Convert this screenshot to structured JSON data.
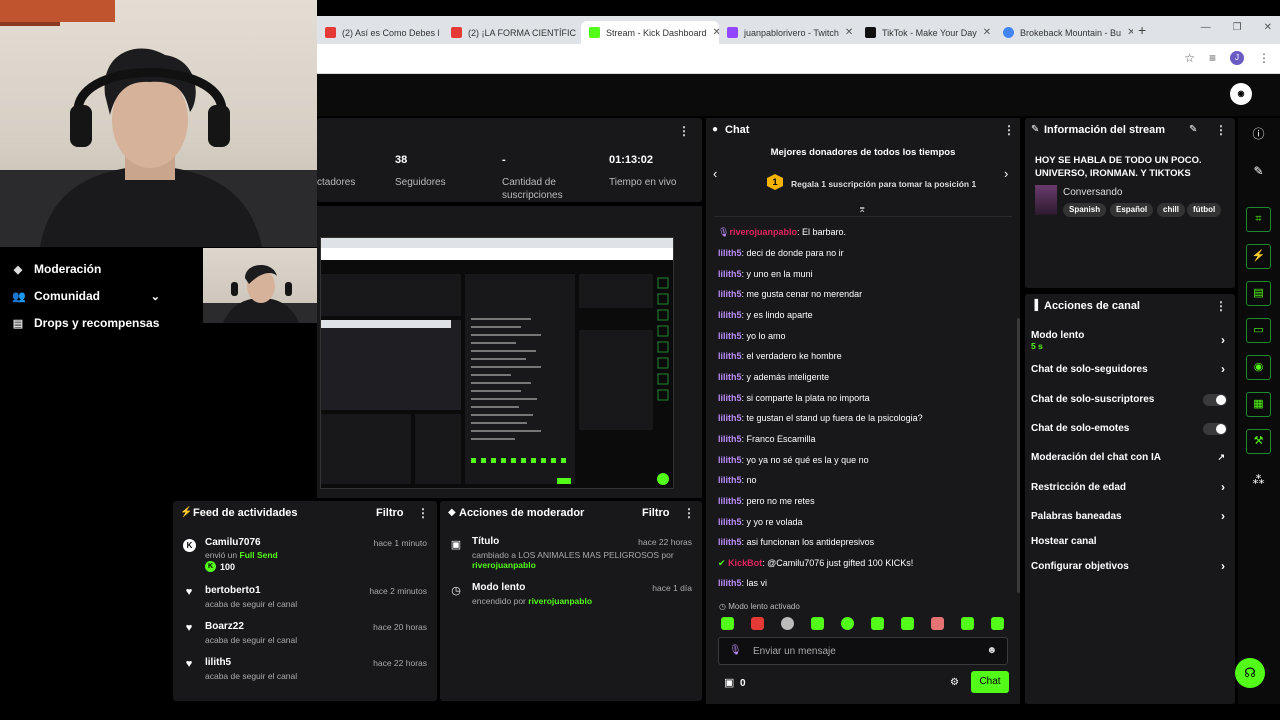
{
  "browser": {
    "tabs": [
      {
        "label": "(2) Así es Como Debes Er",
        "fav": "#e53935"
      },
      {
        "label": "(2) ¡LA FORMA CIENTÍFIC",
        "fav": "#e53935"
      },
      {
        "label": "Stream - Kick Dashboard",
        "fav": "#53fc18",
        "active": true
      },
      {
        "label": "juanpablorivero - Twitch",
        "fav": "#9146ff"
      },
      {
        "label": "TikTok - Make Your Day",
        "fav": "#111111"
      },
      {
        "label": "Brokeback Mountain - Bu",
        "fav": "#4285f4"
      }
    ],
    "profile_letter": "J"
  },
  "nav": {
    "items": [
      {
        "label": "Moderación",
        "icon": "shield-icon"
      },
      {
        "label": "Comunidad",
        "icon": "people-icon"
      },
      {
        "label": "Drops y recompensas",
        "icon": "gift-icon"
      }
    ]
  },
  "stats": {
    "espectadores_label": "ctadores",
    "seguidores_value": "38",
    "seguidores_label": "Seguidores",
    "subs_value": "-",
    "subs_label": "Cantidad de suscripciones",
    "tiempo_value": "01:13:02",
    "tiempo_label": "Tiempo en vivo"
  },
  "feed": {
    "title": "Feed de actividades",
    "filter": "Filtro",
    "items": [
      {
        "name": "Camilu7076",
        "sub_prefix": "envió un ",
        "sub_highlight": "Full Send",
        "extra": "100",
        "time": "hace 1 minuto",
        "icon": "kick-icon"
      },
      {
        "name": "bertoberto1",
        "sub": "acaba de seguir el canal",
        "time": "hace 2 minutos",
        "icon": "heart-icon"
      },
      {
        "name": "Boarz22",
        "sub": "acaba de seguir el canal",
        "time": "hace 20 horas",
        "icon": "heart-icon"
      },
      {
        "name": "lilith5",
        "sub": "acaba de seguir el canal",
        "time": "hace 22 horas",
        "icon": "heart-icon"
      }
    ]
  },
  "modactions": {
    "title": "Acciones de moderador",
    "filter": "Filtro",
    "items": [
      {
        "name": "Título",
        "line1": "cambiado a LOS ANIMALES MAS PELIGROSOS por",
        "user": "riverojuanpablo",
        "time": "hace 22 horas"
      },
      {
        "name": "Modo lento",
        "line1": "encendido por",
        "user": "riverojuanpablo",
        "time": "hace 1 día"
      }
    ]
  },
  "chat": {
    "title": "Chat",
    "donors_title": "Mejores donadores de todos los tiempos",
    "donors_rank": "1",
    "donors_text": "Regala 1 suscripción para tomar la posición 1",
    "messages": [
      {
        "user": "riverojuanpablo",
        "text": "El barbaro.",
        "color": "red"
      },
      {
        "user": "lilith5",
        "text": "deci de donde para no ir"
      },
      {
        "user": "lilith5",
        "text": "y uno en la muni"
      },
      {
        "user": "lilith5",
        "text": "me gusta cenar no merendar"
      },
      {
        "user": "lilith5",
        "text": "y es lindo aparte"
      },
      {
        "user": "lilith5",
        "text": "yo lo amo"
      },
      {
        "user": "lilith5",
        "text": "el verdadero ke hombre"
      },
      {
        "user": "lilith5",
        "text": "y además inteligente"
      },
      {
        "user": "lilith5",
        "text": "si comparte la plata no importa"
      },
      {
        "user": "lilith5",
        "text": "te gustan el stand up fuera de la psicologia?"
      },
      {
        "user": "lilith5",
        "text": "Franco Escamilla"
      },
      {
        "user": "lilith5",
        "text": "yo ya no sé qué es la y que no"
      },
      {
        "user": "lilith5",
        "text": "no"
      },
      {
        "user": "lilith5",
        "text": "pero no me retes"
      },
      {
        "user": "lilith5",
        "text": "y yo re volada"
      },
      {
        "user": "lilith5",
        "text": "asi funcionan los antidepresivos"
      },
      {
        "user": "KickBot",
        "text": "@Camilu7076 just gifted 100 KICKs!",
        "color": "red"
      },
      {
        "user": "lilith5",
        "text": "las vi"
      }
    ],
    "slow_mode": "Modo lento activado",
    "input_placeholder": "Enviar un mensaje",
    "points": "0",
    "send": "Chat"
  },
  "info": {
    "title": "Información del stream",
    "stream_title": "HOY SE HABLA DE TODO UN POCO. UNIVERSO, IRONMAN. Y TIKTOKS",
    "category": "Conversando",
    "tags": [
      "Spanish",
      "Español",
      "chill",
      "fútbol"
    ]
  },
  "channel_actions": {
    "title": "Acciones de canal",
    "slow_label": "Modo lento",
    "slow_value": "5 s",
    "followers_only": "Chat de solo-seguidores",
    "subs_only": "Chat de solo-suscriptores",
    "emotes_only": "Chat de solo-emotes",
    "ai_mod": "Moderación del chat con IA",
    "age": "Restricción de edad",
    "banned": "Palabras baneadas",
    "host": "Hostear canal",
    "goals": "Configurar objetivos"
  },
  "colors": {
    "accent": "#53fc18",
    "panel": "#18181b",
    "username": "#b98cf7"
  }
}
